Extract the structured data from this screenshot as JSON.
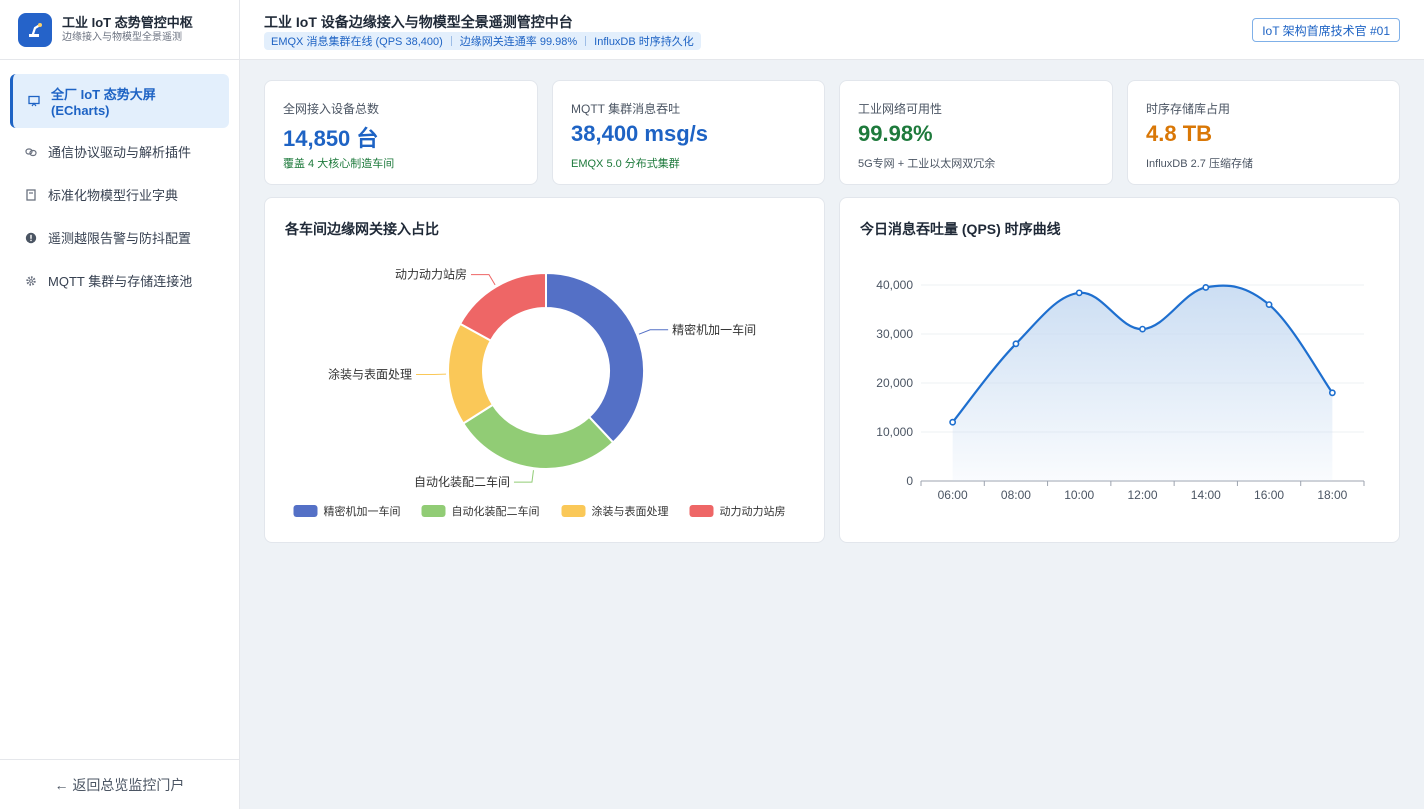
{
  "brand": {
    "title": "工业 IoT 态势管控中枢",
    "subtitle": "边缘接入与物模型全景遥测"
  },
  "sidebar": {
    "items": [
      {
        "label": "全厂 IoT 态势大屏 (ECharts)",
        "icon": "dashboard-icon",
        "active": true
      },
      {
        "label": "通信协议驱动与解析插件",
        "icon": "link-icon"
      },
      {
        "label": "标准化物模型行业字典",
        "icon": "book-icon"
      },
      {
        "label": "遥测越限告警与防抖配置",
        "icon": "alert-icon"
      },
      {
        "label": "MQTT 集群与存储连接池",
        "icon": "gear-icon"
      }
    ],
    "footer": "← 返回总览监控门户"
  },
  "header": {
    "title": "工业 IoT 设备边缘接入与物模型全景遥测管控中台",
    "tags": [
      "EMQX 消息集群在线 (QPS 38,400)",
      "边缘网关连通率 99.98%",
      "InfluxDB 时序持久化"
    ],
    "badge": "IoT 架构首席技术官 #01"
  },
  "kpis": [
    {
      "label": "全网接入设备总数",
      "value": "14,850 台",
      "note": "覆盖 4 大核心制造车间",
      "value_color": "#1e63c4",
      "note_color": "#1e7a3c"
    },
    {
      "label": "MQTT 集群消息吞吐",
      "value": "38,400 msg/s",
      "note": "EMQX 5.0 分布式集群",
      "value_color": "#1e63c4",
      "note_color": "#1e7a3c"
    },
    {
      "label": "工业网络可用性",
      "value": "99.98%",
      "note": "5G专网 + 工业以太网双冗余",
      "value_color": "#1e7a3c",
      "note_color": "#4b5563"
    },
    {
      "label": "时序存储库占用",
      "value": "4.8 TB",
      "note": "InfluxDB 2.7 压缩存储",
      "value_color": "#d97706",
      "note_color": "#4b5563"
    }
  ],
  "charts": {
    "pie_title": "各车间边缘网关接入占比",
    "line_title": "今日消息吞吐量 (QPS) 时序曲线"
  },
  "chart_data": [
    {
      "type": "pie",
      "title": "各车间边缘网关接入占比",
      "legend_position": "bottom",
      "slices": [
        {
          "name": "精密机加一车间",
          "value": 38,
          "color": "#5470c6"
        },
        {
          "name": "自动化装配二车间",
          "value": 28,
          "color": "#91cc75"
        },
        {
          "name": "涂装与表面处理",
          "value": 17,
          "color": "#fac858"
        },
        {
          "name": "动力动力站房",
          "value": 17,
          "color": "#ee6666"
        }
      ]
    },
    {
      "type": "area",
      "title": "今日消息吞吐量 (QPS) 时序曲线",
      "x": [
        "06:00",
        "08:00",
        "10:00",
        "12:00",
        "14:00",
        "16:00",
        "18:00"
      ],
      "y": [
        12000,
        28000,
        38400,
        31000,
        39500,
        36000,
        18000
      ],
      "ylim": [
        0,
        40000
      ],
      "yticks": [
        "0",
        "10,000",
        "20,000",
        "30,000",
        "40,000"
      ],
      "grid": true,
      "color": "#1e6fcf"
    }
  ]
}
